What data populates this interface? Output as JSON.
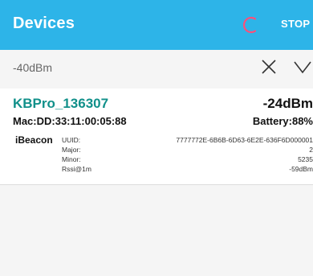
{
  "app_bar": {
    "title": "Devices",
    "stop_label": "STOP",
    "accent_color": "#2db4e8",
    "spinner_color": "#ff4f7a"
  },
  "filter": {
    "value": "-40dBm",
    "clear_icon": "close-icon",
    "expand_icon": "chevron-down-icon"
  },
  "device": {
    "name": "KBPro_136307",
    "rssi": "-24dBm",
    "mac": "Mac:DD:33:11:00:05:88",
    "battery": "Battery:88%",
    "beacon_type": "iBeacon",
    "fields": [
      {
        "label": "UUID:",
        "value": "7777772E-6B6B-6D63-6E2E-636F6D000001"
      },
      {
        "label": "Major:",
        "value": "2"
      },
      {
        "label": "Minor:",
        "value": "5235"
      },
      {
        "label": "Rssi@1m",
        "value": "-59dBm"
      }
    ]
  }
}
